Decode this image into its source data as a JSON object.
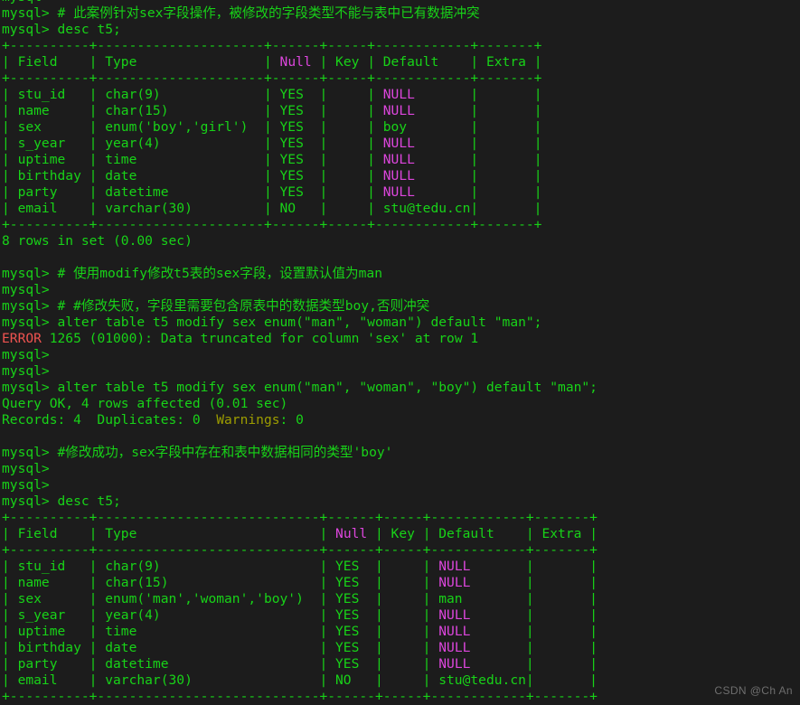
{
  "terminal": {
    "prompt": "mysql> ",
    "colors": {
      "background": "#1c1c1c",
      "green": "#18d318",
      "magenta": "#dd46dd",
      "red": "#ef5350",
      "yellow": "#9d9d00",
      "watermark": "#6e6e6e"
    },
    "lines": [
      {
        "name": "clipped-prompt-line",
        "segments": [
          {
            "t": "mysql>",
            "c": "g"
          }
        ]
      },
      {
        "name": "comment-line-1",
        "segments": [
          {
            "t": "mysql> # 此案例针对sex字段操作，被修改的字段类型不能与表中已有数据冲突",
            "c": "g"
          }
        ]
      },
      {
        "name": "command-desc-t5-first",
        "segments": [
          {
            "t": "mysql> desc t5;",
            "c": "g"
          }
        ]
      },
      {
        "name": "table1-border-top",
        "segments": [
          {
            "t": "+----------+---------------------+------+-----+------------+-------+",
            "c": "g"
          }
        ]
      },
      {
        "name": "table1-header-row",
        "segments": [
          {
            "t": "| Field    | Type                | ",
            "c": "g"
          },
          {
            "t": "Null",
            "c": "mag"
          },
          {
            "t": " | Key | Default    | Extra |",
            "c": "g"
          }
        ]
      },
      {
        "name": "table1-border-header",
        "segments": [
          {
            "t": "+----------+---------------------+------+-----+------------+-------+",
            "c": "g"
          }
        ]
      },
      {
        "name": "table1-row-stu_id",
        "segments": [
          {
            "t": "| stu_id   | char(9)             | YES  |     | ",
            "c": "g"
          },
          {
            "t": "NULL",
            "c": "mag"
          },
          {
            "t": "       |       |",
            "c": "g"
          }
        ]
      },
      {
        "name": "table1-row-name",
        "segments": [
          {
            "t": "| name     | char(15)            | YES  |     | ",
            "c": "g"
          },
          {
            "t": "NULL",
            "c": "mag"
          },
          {
            "t": "       |       |",
            "c": "g"
          }
        ]
      },
      {
        "name": "table1-row-sex",
        "segments": [
          {
            "t": "| sex      | enum('boy','girl')  | YES  |     | boy        |       |",
            "c": "g"
          }
        ]
      },
      {
        "name": "table1-row-s_year",
        "segments": [
          {
            "t": "| s_year   | year(4)             | YES  |     | ",
            "c": "g"
          },
          {
            "t": "NULL",
            "c": "mag"
          },
          {
            "t": "       |       |",
            "c": "g"
          }
        ]
      },
      {
        "name": "table1-row-uptime",
        "segments": [
          {
            "t": "| uptime   | time                | YES  |     | ",
            "c": "g"
          },
          {
            "t": "NULL",
            "c": "mag"
          },
          {
            "t": "       |       |",
            "c": "g"
          }
        ]
      },
      {
        "name": "table1-row-birthday",
        "segments": [
          {
            "t": "| birthday | date                | YES  |     | ",
            "c": "g"
          },
          {
            "t": "NULL",
            "c": "mag"
          },
          {
            "t": "       |       |",
            "c": "g"
          }
        ]
      },
      {
        "name": "table1-row-party",
        "segments": [
          {
            "t": "| party    | datetime            | YES  |     | ",
            "c": "g"
          },
          {
            "t": "NULL",
            "c": "mag"
          },
          {
            "t": "       |       |",
            "c": "g"
          }
        ]
      },
      {
        "name": "table1-row-email",
        "segments": [
          {
            "t": "| email    | varchar(30)         | NO   |     | stu@tedu.cn|       |",
            "c": "g"
          }
        ]
      },
      {
        "name": "table1-border-bottom",
        "segments": [
          {
            "t": "+----------+---------------------+------+-----+------------+-------+",
            "c": "g"
          }
        ]
      },
      {
        "name": "table1-rowcount",
        "segments": [
          {
            "t": "8 rows in set (0.00 sec)",
            "c": "g"
          }
        ]
      },
      {
        "name": "blank-1",
        "segments": [
          {
            "t": "",
            "c": "g"
          }
        ]
      },
      {
        "name": "comment-line-2",
        "segments": [
          {
            "t": "mysql> # 使用modify修改t5表的sex字段，设置默认值为man",
            "c": "g"
          }
        ]
      },
      {
        "name": "empty-prompt-1",
        "segments": [
          {
            "t": "mysql>",
            "c": "g"
          }
        ]
      },
      {
        "name": "comment-line-3",
        "segments": [
          {
            "t": "mysql> # #修改失败，字段里需要包含原表中的数据类型boy,否则冲突",
            "c": "g"
          }
        ]
      },
      {
        "name": "command-alter-fail",
        "segments": [
          {
            "t": "mysql> alter table t5 modify sex enum(\"man\", \"woman\") default \"man\";",
            "c": "g"
          }
        ]
      },
      {
        "name": "error-line",
        "segments": [
          {
            "t": "ERROR",
            "c": "red"
          },
          {
            "t": " 1265 (01000): Data truncated for column 'sex' at row 1",
            "c": "g"
          }
        ]
      },
      {
        "name": "empty-prompt-2",
        "segments": [
          {
            "t": "mysql>",
            "c": "g"
          }
        ]
      },
      {
        "name": "empty-prompt-3",
        "segments": [
          {
            "t": "mysql>",
            "c": "g"
          }
        ]
      },
      {
        "name": "command-alter-success",
        "segments": [
          {
            "t": "mysql> alter table t5 modify sex enum(\"man\", \"woman\", \"boy\") default \"man\";",
            "c": "g"
          }
        ]
      },
      {
        "name": "query-ok-line",
        "segments": [
          {
            "t": "Query OK, 4 rows affected (0.01 sec)",
            "c": "g"
          }
        ]
      },
      {
        "name": "records-line",
        "segments": [
          {
            "t": "Records: 4  Duplicates: 0  ",
            "c": "g"
          },
          {
            "t": "Warnings",
            "c": "yel"
          },
          {
            "t": ": 0",
            "c": "g"
          }
        ]
      },
      {
        "name": "blank-2",
        "segments": [
          {
            "t": "",
            "c": "g"
          }
        ]
      },
      {
        "name": "comment-line-4",
        "segments": [
          {
            "t": "mysql> #修改成功，sex字段中存在和表中数据相同的类型'boy'",
            "c": "g"
          }
        ]
      },
      {
        "name": "empty-prompt-4",
        "segments": [
          {
            "t": "mysql>",
            "c": "g"
          }
        ]
      },
      {
        "name": "empty-prompt-5",
        "segments": [
          {
            "t": "mysql>",
            "c": "g"
          }
        ]
      },
      {
        "name": "command-desc-t5-second",
        "segments": [
          {
            "t": "mysql> desc t5;",
            "c": "g"
          }
        ]
      },
      {
        "name": "table2-border-top",
        "segments": [
          {
            "t": "+----------+----------------------------+------+-----+------------+-------+",
            "c": "g"
          }
        ]
      },
      {
        "name": "table2-header-row",
        "segments": [
          {
            "t": "| Field    | Type                       | ",
            "c": "g"
          },
          {
            "t": "Null",
            "c": "mag"
          },
          {
            "t": " | Key | Default    | Extra |",
            "c": "g"
          }
        ]
      },
      {
        "name": "table2-border-header",
        "segments": [
          {
            "t": "+----------+----------------------------+------+-----+------------+-------+",
            "c": "g"
          }
        ]
      },
      {
        "name": "table2-row-stu_id",
        "segments": [
          {
            "t": "| stu_id   | char(9)                    | YES  |     | ",
            "c": "g"
          },
          {
            "t": "NULL",
            "c": "mag"
          },
          {
            "t": "       |       |",
            "c": "g"
          }
        ]
      },
      {
        "name": "table2-row-name",
        "segments": [
          {
            "t": "| name     | char(15)                   | YES  |     | ",
            "c": "g"
          },
          {
            "t": "NULL",
            "c": "mag"
          },
          {
            "t": "       |       |",
            "c": "g"
          }
        ]
      },
      {
        "name": "table2-row-sex",
        "segments": [
          {
            "t": "| sex      | enum('man','woman','boy')  | YES  |     | man        |       |",
            "c": "g"
          }
        ]
      },
      {
        "name": "table2-row-s_year",
        "segments": [
          {
            "t": "| s_year   | year(4)                    | YES  |     | ",
            "c": "g"
          },
          {
            "t": "NULL",
            "c": "mag"
          },
          {
            "t": "       |       |",
            "c": "g"
          }
        ]
      },
      {
        "name": "table2-row-uptime",
        "segments": [
          {
            "t": "| uptime   | time                       | YES  |     | ",
            "c": "g"
          },
          {
            "t": "NULL",
            "c": "mag"
          },
          {
            "t": "       |       |",
            "c": "g"
          }
        ]
      },
      {
        "name": "table2-row-birthday",
        "segments": [
          {
            "t": "| birthday | date                       | YES  |     | ",
            "c": "g"
          },
          {
            "t": "NULL",
            "c": "mag"
          },
          {
            "t": "       |       |",
            "c": "g"
          }
        ]
      },
      {
        "name": "table2-row-party",
        "segments": [
          {
            "t": "| party    | datetime                   | YES  |     | ",
            "c": "g"
          },
          {
            "t": "NULL",
            "c": "mag"
          },
          {
            "t": "       |       |",
            "c": "g"
          }
        ]
      },
      {
        "name": "table2-row-email",
        "segments": [
          {
            "t": "| email    | varchar(30)                | NO   |     | stu@tedu.cn|       |",
            "c": "g"
          }
        ]
      },
      {
        "name": "table2-border-bottom",
        "segments": [
          {
            "t": "+----------+----------------------------+------+-----+------------+-------+",
            "c": "g"
          }
        ]
      }
    ]
  },
  "watermark": {
    "text": "CSDN @Ch An"
  }
}
